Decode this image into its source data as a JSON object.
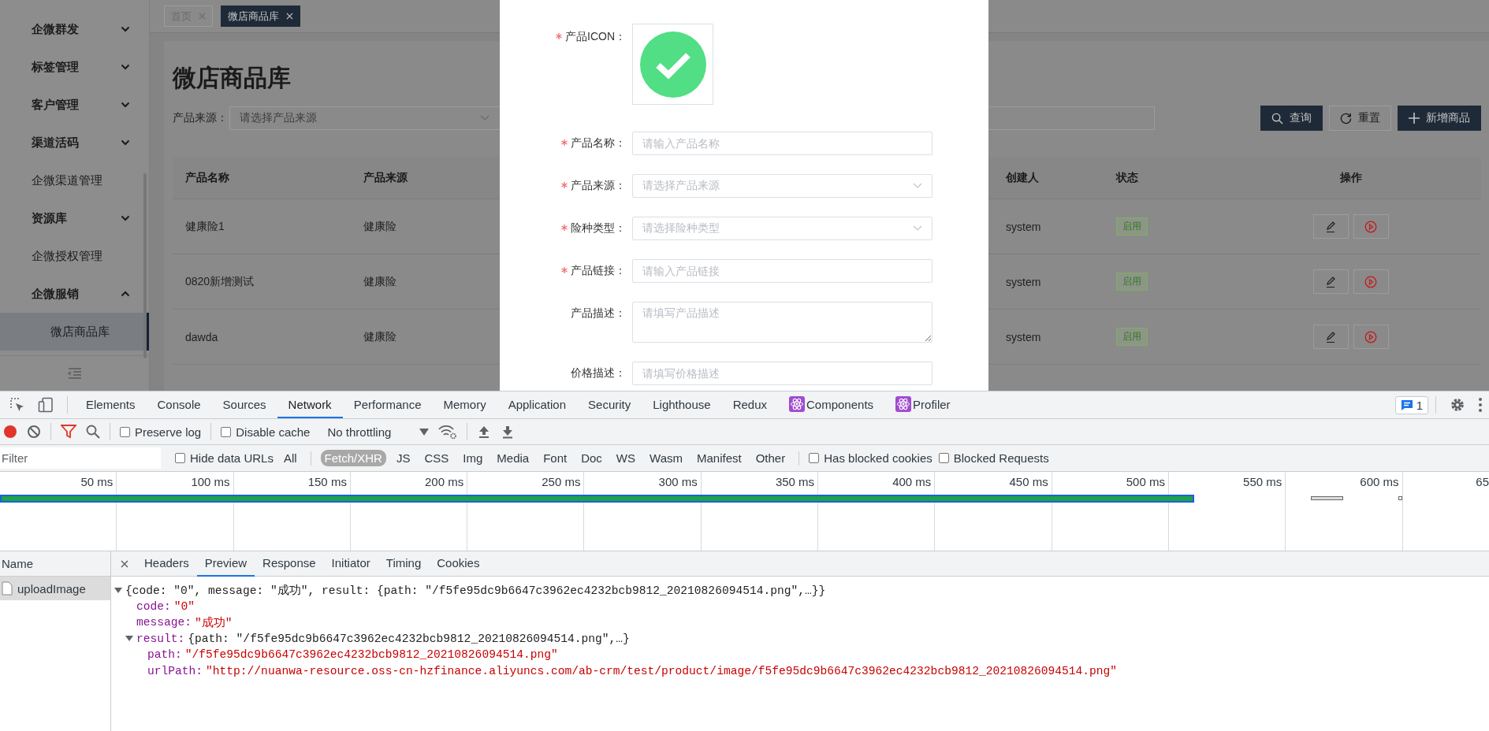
{
  "sidebar": {
    "items": [
      {
        "label": "企微群发",
        "kind": "group",
        "expanded": false
      },
      {
        "label": "标签管理",
        "kind": "group",
        "expanded": false
      },
      {
        "label": "客户管理",
        "kind": "group",
        "expanded": false
      },
      {
        "label": "渠道活码",
        "kind": "group",
        "expanded": false
      },
      {
        "label": "企微渠道管理",
        "kind": "link"
      },
      {
        "label": "资源库",
        "kind": "group",
        "expanded": false
      },
      {
        "label": "企微授权管理",
        "kind": "link"
      },
      {
        "label": "企微服销",
        "kind": "group",
        "expanded": true,
        "children": [
          {
            "label": "微店商品库",
            "selected": true
          }
        ]
      }
    ]
  },
  "tabs": [
    {
      "label": "首页",
      "selected": false
    },
    {
      "label": "微店商品库",
      "selected": true
    }
  ],
  "page": {
    "title": "微店商品库",
    "filter": {
      "label": "产品来源：",
      "placeholder": "请选择产品来源"
    },
    "buttons": [
      {
        "label": "查询",
        "kind": "primary"
      },
      {
        "label": "重置",
        "kind": "default"
      },
      {
        "label": "新增商品",
        "kind": "primary"
      }
    ]
  },
  "table": {
    "columns_left": [
      "产品名称",
      "产品来源"
    ],
    "columns_right": [
      "创建人",
      "状态",
      "操作"
    ],
    "rows": [
      {
        "name": "健康险1",
        "source": "健康险",
        "creator": "system",
        "status": "启用"
      },
      {
        "name": "0820新增测试",
        "source": "健康险",
        "creator": "system",
        "status": "启用"
      },
      {
        "name": "dawda",
        "source": "健康险",
        "creator": "system",
        "status": "启用"
      }
    ]
  },
  "dialog": {
    "fields": [
      {
        "kind": "upload",
        "label": "产品ICON：",
        "required": true
      },
      {
        "kind": "input",
        "label": "产品名称：",
        "required": true,
        "placeholder": "请输入产品名称"
      },
      {
        "kind": "select",
        "label": "产品来源：",
        "required": true,
        "placeholder": "请选择产品来源"
      },
      {
        "kind": "select",
        "label": "险种类型：",
        "required": true,
        "placeholder": "请选择险种类型"
      },
      {
        "kind": "input",
        "label": "产品链接：",
        "required": true,
        "placeholder": "请输入产品链接"
      },
      {
        "kind": "textarea",
        "label": "产品描述：",
        "required": false,
        "placeholder": "请填写产品描述"
      },
      {
        "kind": "input",
        "label": "价格描述：",
        "required": false,
        "placeholder": "请填写价格描述"
      }
    ]
  },
  "devtools": {
    "tabs": [
      {
        "label": "Elements",
        "selected": false
      },
      {
        "label": "Console",
        "selected": false
      },
      {
        "label": "Sources",
        "selected": false
      },
      {
        "label": "Network",
        "selected": true
      },
      {
        "label": "Performance",
        "selected": false
      },
      {
        "label": "Memory",
        "selected": false
      },
      {
        "label": "Application",
        "selected": false
      },
      {
        "label": "Security",
        "selected": false
      },
      {
        "label": "Lighthouse",
        "selected": false
      },
      {
        "label": "Redux",
        "selected": false
      },
      {
        "label": "Components",
        "selected": false,
        "kind": "extension"
      },
      {
        "label": "Profiler",
        "selected": false,
        "kind": "extension"
      }
    ],
    "issues_badge": "1",
    "toolbar": {
      "recording": true,
      "filter_active": true,
      "preserve_log": {
        "label": "Preserve log",
        "checked": false
      },
      "disable_cache": {
        "label": "Disable cache",
        "checked": false
      },
      "throttling": "No throttling"
    },
    "filter_bar": {
      "placeholder": "Filter",
      "hide_data_urls": {
        "label": "Hide data URLs",
        "checked": false
      },
      "types": [
        {
          "label": "All",
          "selected": false
        },
        {
          "label": "Fetch/XHR",
          "selected": true
        },
        {
          "label": "JS",
          "selected": false
        },
        {
          "label": "CSS",
          "selected": false
        },
        {
          "label": "Img",
          "selected": false
        },
        {
          "label": "Media",
          "selected": false
        },
        {
          "label": "Font",
          "selected": false
        },
        {
          "label": "Doc",
          "selected": false
        },
        {
          "label": "WS",
          "selected": false
        },
        {
          "label": "Wasm",
          "selected": false
        },
        {
          "label": "Manifest",
          "selected": false
        },
        {
          "label": "Other",
          "selected": false
        }
      ],
      "has_blocked_cookies": {
        "label": "Has blocked cookies",
        "checked": false
      },
      "blocked_requests": {
        "label": "Blocked Requests",
        "checked": false
      }
    },
    "timeline": {
      "ticks": [
        "50 ms",
        "100 ms",
        "150 ms",
        "200 ms",
        "250 ms",
        "300 ms",
        "350 ms",
        "400 ms",
        "450 ms",
        "500 ms",
        "550 ms",
        "600 ms",
        "65"
      ]
    },
    "requests": {
      "header": "Name",
      "items": [
        {
          "name": "uploadImage",
          "selected": true
        }
      ]
    },
    "detail": {
      "tabs": [
        {
          "label": "Headers",
          "selected": false
        },
        {
          "label": "Preview",
          "selected": true
        },
        {
          "label": "Response",
          "selected": false
        },
        {
          "label": "Initiator",
          "selected": false
        },
        {
          "label": "Timing",
          "selected": false
        },
        {
          "label": "Cookies",
          "selected": false
        }
      ],
      "preview": {
        "summary": "{code: \"0\", message: \"成功\", result: {path: \"/f5fe95dc9b6647c3962ec4232bcb9812_20210826094514.png\",…}}",
        "expanded": true,
        "children": [
          {
            "key": "code:",
            "kind": "string",
            "value": "\"0\""
          },
          {
            "key": "message:",
            "kind": "string",
            "value": "\"成功\""
          },
          {
            "key": "result:",
            "kind": "object",
            "expanded": true,
            "summary": "{path: \"/f5fe95dc9b6647c3962ec4232bcb9812_20210826094514.png\",…}",
            "children": [
              {
                "key": "path:",
                "kind": "string",
                "value": "\"/f5fe95dc9b6647c3962ec4232bcb9812_20210826094514.png\""
              },
              {
                "key": "urlPath:",
                "kind": "string",
                "value": "\"http://nuanwa-resource.oss-cn-hzfinance.aliyuncs.com/ab-crm/test/product/image/f5fe95dc9b6647c3962ec4232bcb9812_20210826094514.png\""
              }
            ]
          }
        ]
      }
    }
  }
}
